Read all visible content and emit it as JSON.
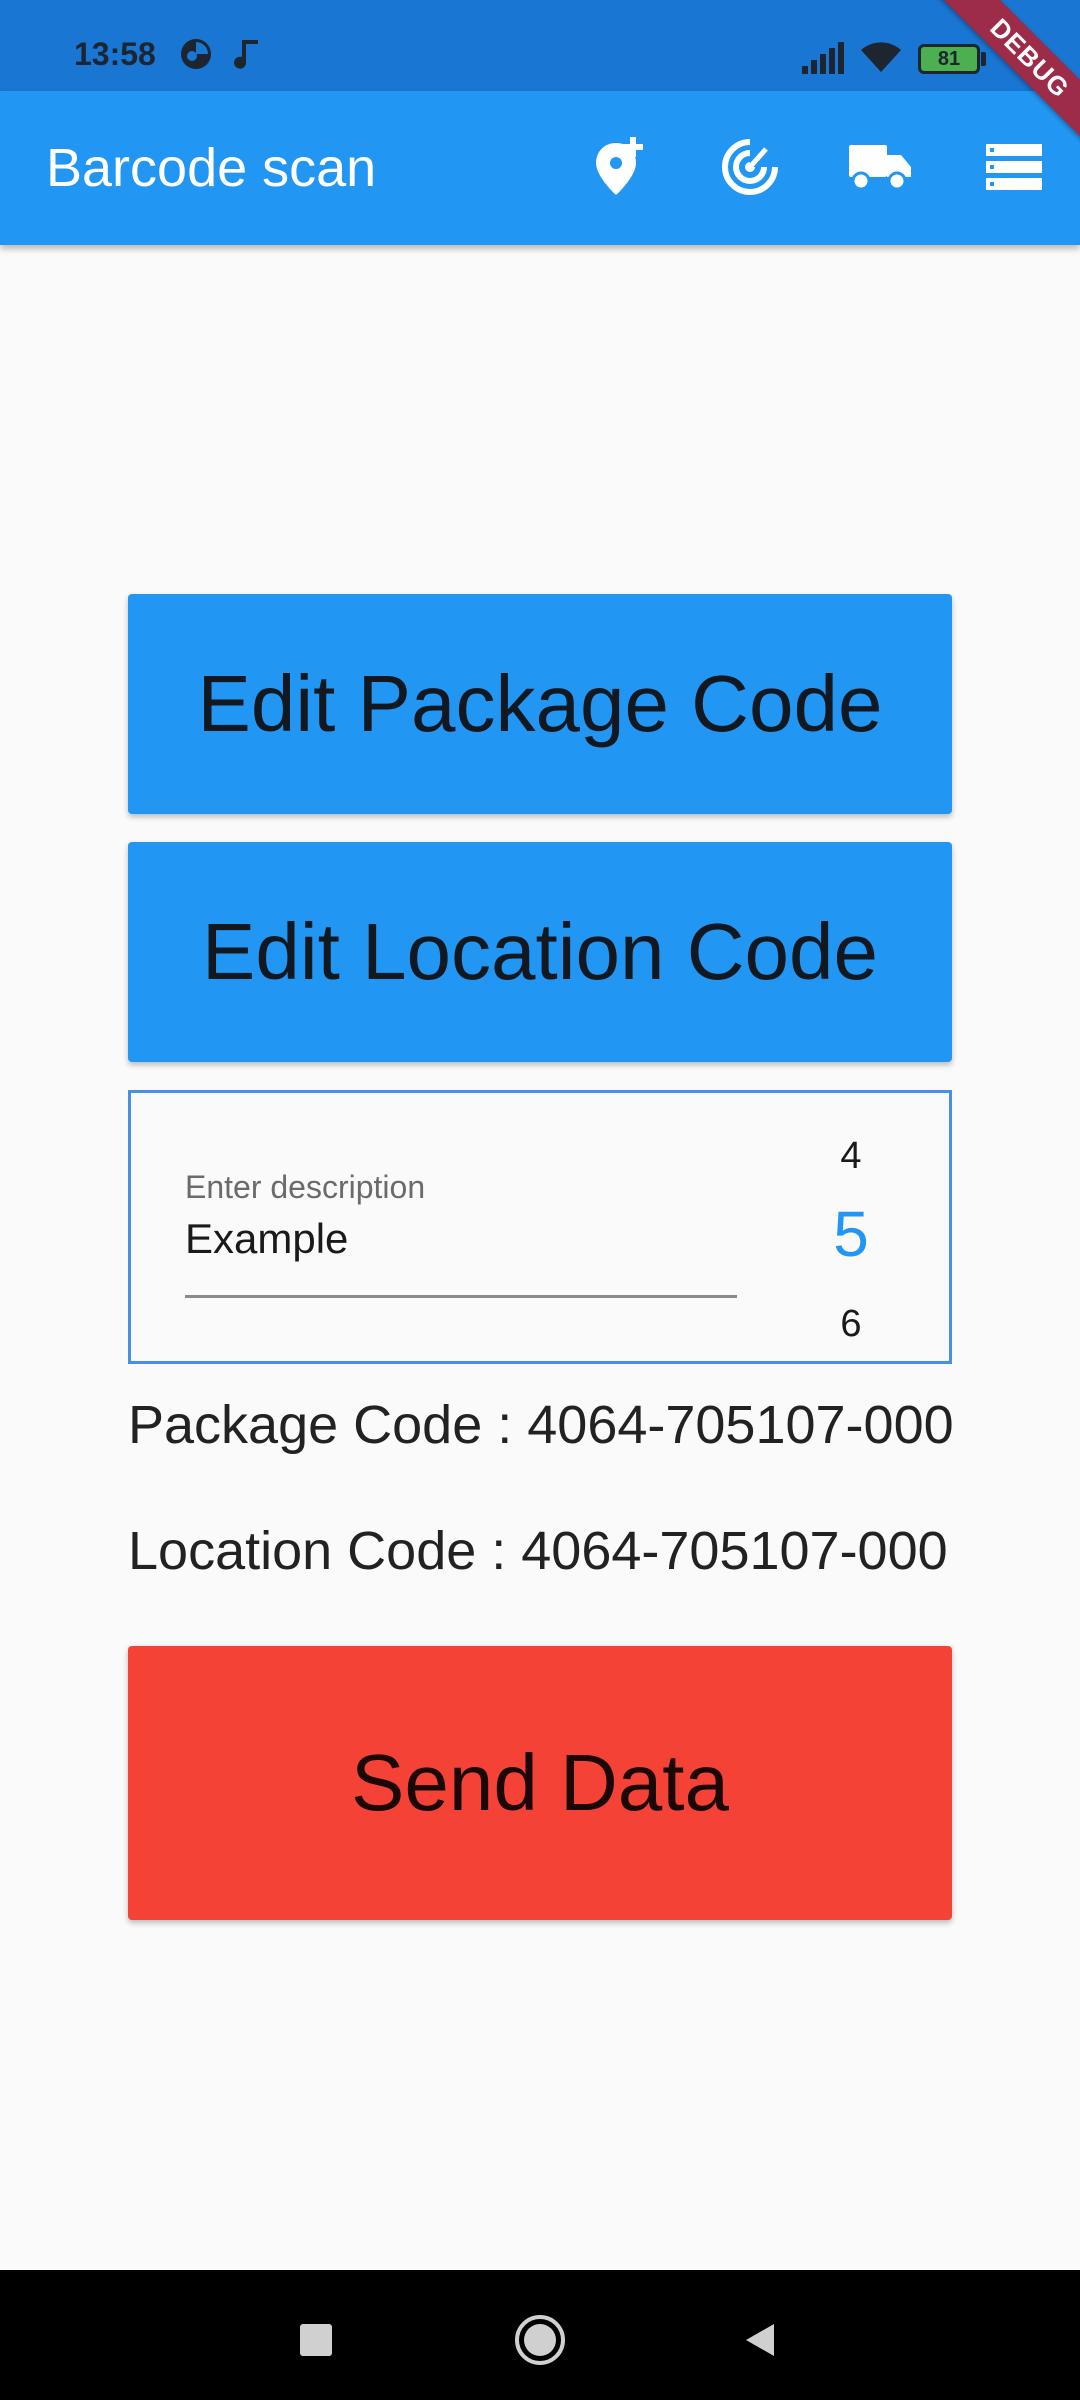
{
  "status_bar": {
    "time": "13:58",
    "battery": "81",
    "debug_label": "DEBUG",
    "icons": [
      "circle-status-icon",
      "music-note-icon",
      "signal-icon",
      "wifi-icon",
      "battery-icon"
    ]
  },
  "app_bar": {
    "title": "Barcode scan",
    "actions": [
      "add-location-icon",
      "radar-icon",
      "truck-icon",
      "list-icon"
    ]
  },
  "buttons": {
    "edit_package": "Edit Package Code",
    "edit_location": "Edit Location Code",
    "send": "Send Data"
  },
  "description": {
    "label": "Enter description",
    "value": "Example",
    "picker": {
      "prev": "4",
      "selected": "5",
      "next": "6"
    }
  },
  "info": {
    "package": "Package Code : 4064-705107-000",
    "location": "Location Code : 4064-705107-000"
  },
  "colors": {
    "primary": "#2196f3",
    "status_bar": "#1976d2",
    "send": "#f44336",
    "debug": "#9c2c48"
  },
  "nav_bar": {
    "buttons": [
      "recents-icon",
      "home-icon",
      "back-icon"
    ]
  }
}
